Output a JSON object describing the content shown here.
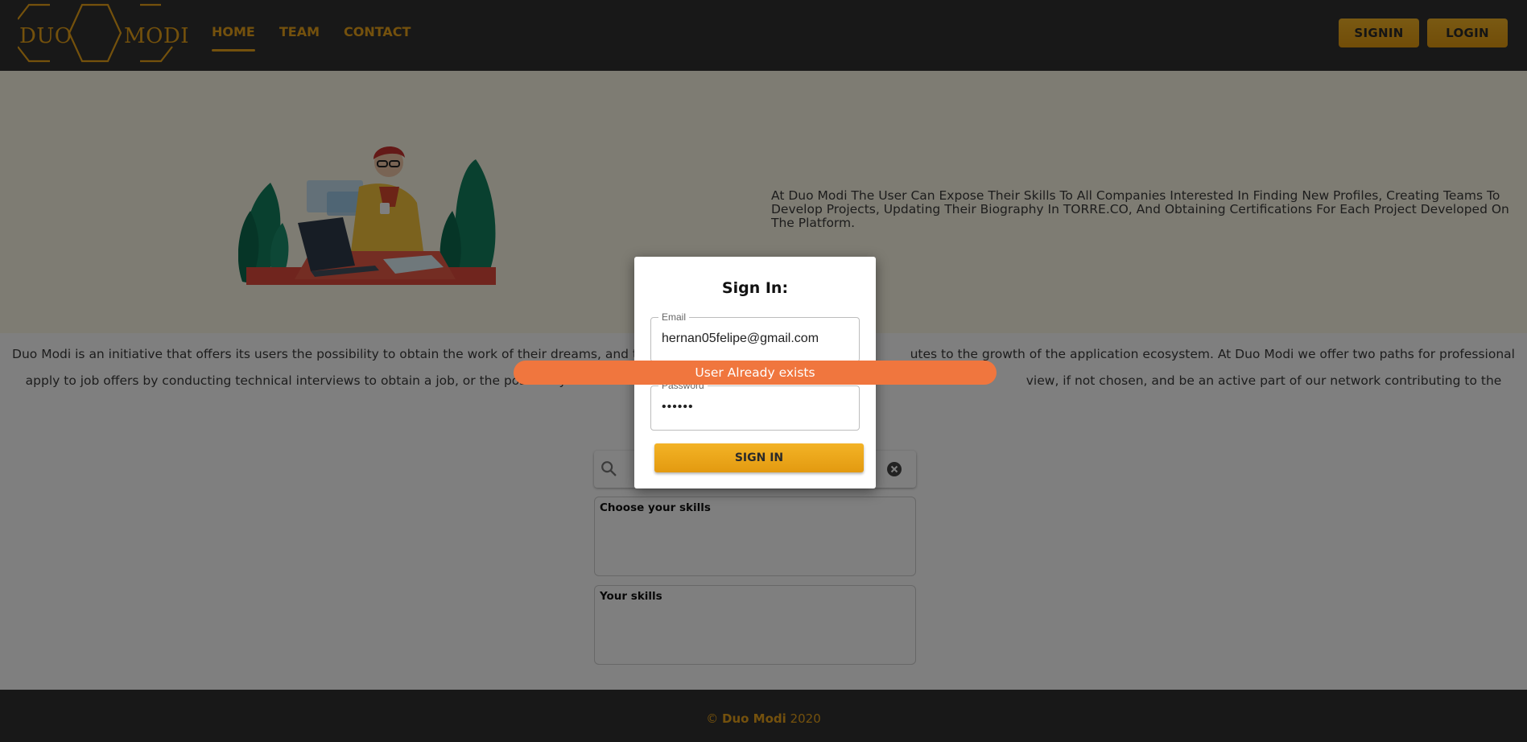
{
  "header": {
    "logo": {
      "left": "DUO",
      "right": "MODI"
    },
    "nav": [
      {
        "label": "HOME",
        "active": true
      },
      {
        "label": "TEAM",
        "active": false
      },
      {
        "label": "CONTACT",
        "active": false
      }
    ],
    "signin_label": "SIGNIN",
    "login_label": "LOGIN"
  },
  "hero": {
    "text": "At Duo Modi The User Can Expose Their Skills To All Companies Interested In Finding New Profiles, Creating Teams To Develop Projects, Updating Their Biography In TORRE.CO, And Obtaining Certifications For Each Project Developed On The Platform."
  },
  "about": {
    "line1": "Duo Modi is an initiative that offers its users the possibility to obtain the work of their dreams, and to be p",
    "line1_end": "utes to the growth of the application ecosystem. At Duo Modi we offer two paths for professional growth,",
    "line2": "apply to job offers by conducting technical interviews to obtain a job, or the possibility t",
    "line2_end": "view, if not chosen, and be an active part of our network contributing to the creation and"
  },
  "skills": {
    "choose_title": "Choose your skills",
    "your_title": "Your skills",
    "search_icon": "search-icon",
    "clear_icon": "clear-icon"
  },
  "footer": {
    "copyright": "©",
    "brand": "Duo Modi",
    "year": "2020"
  },
  "modal": {
    "title": "Sign In:",
    "email_label": "Email",
    "email_value": "hernan05felipe@gmail.com",
    "password_label": "Password",
    "password_value": "••••••",
    "submit_label": "SIGN IN"
  },
  "toast": {
    "message": "User Already exists"
  },
  "colors": {
    "accent": "#e8a21a",
    "header_bg": "#303030",
    "hero_bg": "#fdf8e6",
    "toast_bg": "#f0763e"
  }
}
